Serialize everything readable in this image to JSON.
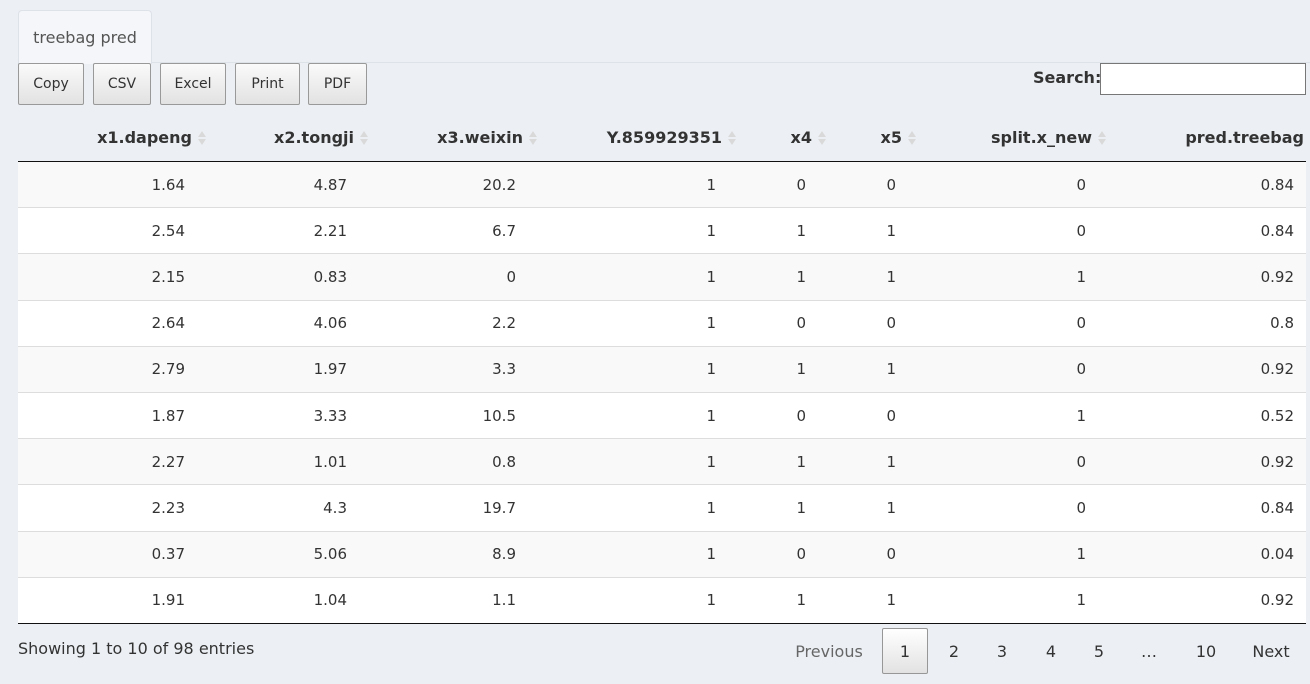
{
  "tab": {
    "label": "treebag pred"
  },
  "toolbar": {
    "buttons": [
      "Copy",
      "CSV",
      "Excel",
      "Print",
      "PDF"
    ]
  },
  "search": {
    "label": "Search:",
    "value": ""
  },
  "table": {
    "columns": [
      "x1.dapeng",
      "x2.tongji",
      "x3.weixin",
      "Y.859929351",
      "x4",
      "x5",
      "split.x_new",
      "pred.treebag"
    ],
    "rows": [
      [
        "1.64",
        "4.87",
        "20.2",
        "1",
        "0",
        "0",
        "0",
        "0.84"
      ],
      [
        "2.54",
        "2.21",
        "6.7",
        "1",
        "1",
        "1",
        "0",
        "0.84"
      ],
      [
        "2.15",
        "0.83",
        "0",
        "1",
        "1",
        "1",
        "1",
        "0.92"
      ],
      [
        "2.64",
        "4.06",
        "2.2",
        "1",
        "0",
        "0",
        "0",
        "0.8"
      ],
      [
        "2.79",
        "1.97",
        "3.3",
        "1",
        "1",
        "1",
        "0",
        "0.92"
      ],
      [
        "1.87",
        "3.33",
        "10.5",
        "1",
        "0",
        "0",
        "1",
        "0.52"
      ],
      [
        "2.27",
        "1.01",
        "0.8",
        "1",
        "1",
        "1",
        "0",
        "0.92"
      ],
      [
        "2.23",
        "4.3",
        "19.7",
        "1",
        "1",
        "1",
        "0",
        "0.84"
      ],
      [
        "0.37",
        "5.06",
        "8.9",
        "1",
        "0",
        "0",
        "1",
        "0.04"
      ],
      [
        "1.91",
        "1.04",
        "1.1",
        "1",
        "1",
        "1",
        "1",
        "0.92"
      ]
    ]
  },
  "footer": {
    "info": "Showing 1 to 10 of 98 entries",
    "previous": "Previous",
    "pages": [
      "1",
      "2",
      "3",
      "4",
      "5",
      "…",
      "10"
    ],
    "current_page": "1",
    "next": "Next"
  }
}
